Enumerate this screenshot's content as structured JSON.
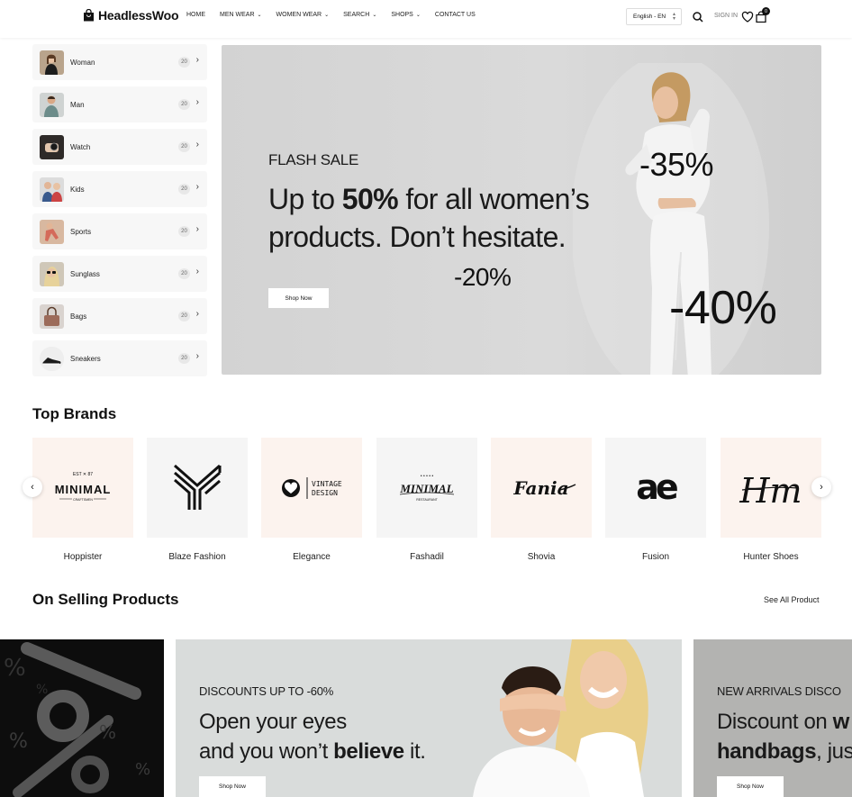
{
  "header": {
    "logo": "HeadlessWoo",
    "nav": [
      {
        "label": "HOME",
        "dropdown": false
      },
      {
        "label": "MEN WEAR",
        "dropdown": true
      },
      {
        "label": "WOMEN WEAR",
        "dropdown": true
      },
      {
        "label": "SEARCH",
        "dropdown": true
      },
      {
        "label": "SHOPS",
        "dropdown": true
      },
      {
        "label": "CONTACT US",
        "dropdown": false
      }
    ],
    "language": "English - EN",
    "signin": "SIGN IN",
    "cart_count": "0"
  },
  "sidebar": {
    "categories": [
      {
        "label": "Woman",
        "count": "20"
      },
      {
        "label": "Man",
        "count": "20"
      },
      {
        "label": "Watch",
        "count": "20"
      },
      {
        "label": "Kids",
        "count": "20"
      },
      {
        "label": "Sports",
        "count": "20"
      },
      {
        "label": "Sunglass",
        "count": "20"
      },
      {
        "label": "Bags",
        "count": "20"
      },
      {
        "label": "Sneakers",
        "count": "20"
      }
    ]
  },
  "hero": {
    "kicker": "FLASH SALE",
    "title_pre": "Up to ",
    "title_bold": "50%",
    "title_post": " for all women’s products. Don’t hesitate.",
    "badge_1": "-35%",
    "badge_2": "-20%",
    "badge_3": "-40%",
    "button": "Shop Now"
  },
  "brands": {
    "title": "Top Brands",
    "items": [
      {
        "name": "Hoppister",
        "logo_text": "MINIMAL",
        "logo_sub": "CRAFTSMEN",
        "logo_top": "EST  ✕  87"
      },
      {
        "name": "Blaze Fashion"
      },
      {
        "name": "Elegance",
        "logo_text": "VINTAGE",
        "logo_text2": "DESIGN"
      },
      {
        "name": "Fashadil",
        "logo_text": "MINIMAL",
        "logo_sub": "RESTAURANT",
        "logo_top": "• • • • •"
      },
      {
        "name": "Shovia",
        "logo_text": "Fania"
      },
      {
        "name": "Fusion",
        "logo_text": "ae"
      },
      {
        "name": "Hunter Shoes",
        "logo_text": "Hm"
      }
    ]
  },
  "products": {
    "title": "On Selling Products",
    "see_all": "See All Product",
    "banners": [
      {
        "kicker": "DISCOUNTS UP TO -60%",
        "line1": "Open your eyes",
        "line2_pre": "and you won’t ",
        "line2_bold": "believe",
        "line2_post": " it.",
        "button": "Shop Now"
      },
      {
        "kicker": "NEW ARRIVALS DISCO",
        "line1_pre": "Discount on ",
        "line1_bold": "w",
        "line2_bold": "handbags",
        "line2_post": ", jus",
        "button": "Shop Now"
      }
    ]
  },
  "colors": {
    "brand_tile_warm": "#fcf3ee",
    "brand_tile_cool": "#f5f5f5",
    "hero_bg": "#d6d6d6"
  }
}
